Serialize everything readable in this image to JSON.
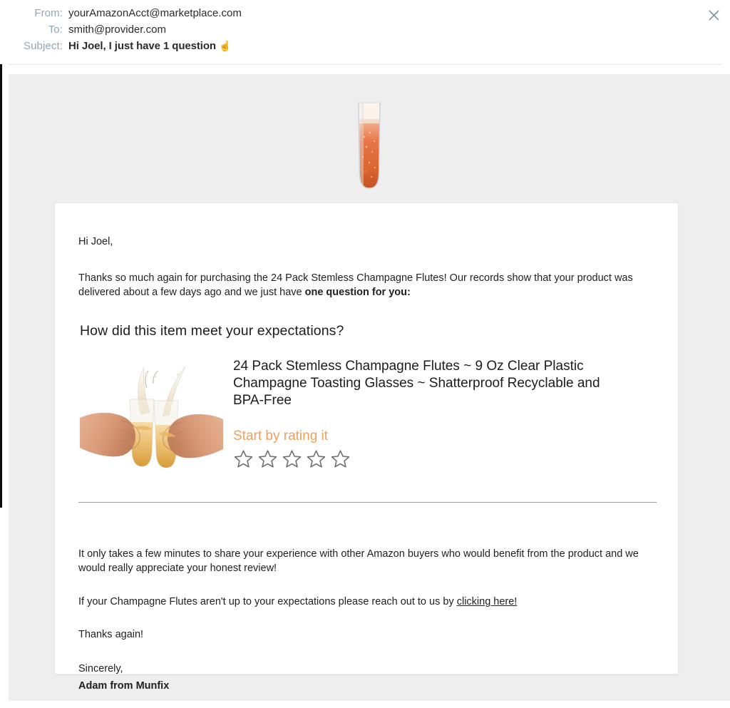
{
  "window": {
    "close_icon": "close-icon"
  },
  "header": {
    "rows": [
      {
        "label": "From:",
        "value": "yourAmazonAcct@marketplace.com",
        "bold": false
      },
      {
        "label": "To:",
        "value": "smith@provider.com",
        "bold": false
      },
      {
        "label": "Subject:",
        "value": "Hi Joel, I just have 1 question",
        "bold": true
      }
    ],
    "from_label": "From:",
    "from_value": "yourAmazonAcct@marketplace.com",
    "to_label": "To:",
    "to_value": "smith@provider.com",
    "subject_label": "Subject:",
    "subject_value": "Hi Joel, I just have 1 question",
    "subject_emoji": "☝️",
    "label_color": "#93a7b8"
  },
  "hero": {
    "image_name": "champagne-flute-image",
    "alt": "Stemless champagne flute filled with sparkling rose"
  },
  "message": {
    "greeting": "Hi Joel,",
    "intro_part_1": "Thanks so much again for purchasing the 24 Pack Stemless Champagne Flutes! Our records show that your product was delivered about a few days ago and we just have ",
    "intro_bold": "one question for you:",
    "question_heading": "How did this item meet your expectations?"
  },
  "product": {
    "image_name": "champagne-toast-product-image",
    "alt": "Two hands clinking stemless champagne flutes with splashing champagne",
    "title": "24 Pack Stemless Champagne Flutes ~ 9 Oz Clear Plastic Champagne Toasting Glasses ~ Shatterproof Recyclable and BPA-Free",
    "rating_prompt": "Start by rating it",
    "rating_prompt_color": "#f0a05a",
    "stars_total": 5,
    "stars_filled": 0,
    "star_color": "#6e6e6e"
  },
  "footer": {
    "paragraph_1": "It only takes a few minutes to share your experience with other Amazon buyers who would benefit from the product and we would really appreciate your honest review!",
    "paragraph_2_prefix": "If your Champagne Flutes aren't up to your expectations please reach out to us by ",
    "support_link_text": "clicking here!",
    "thanks_again": "Thanks again!",
    "signoff": "Sincerely,",
    "signature_name": "Adam from Munfix"
  }
}
